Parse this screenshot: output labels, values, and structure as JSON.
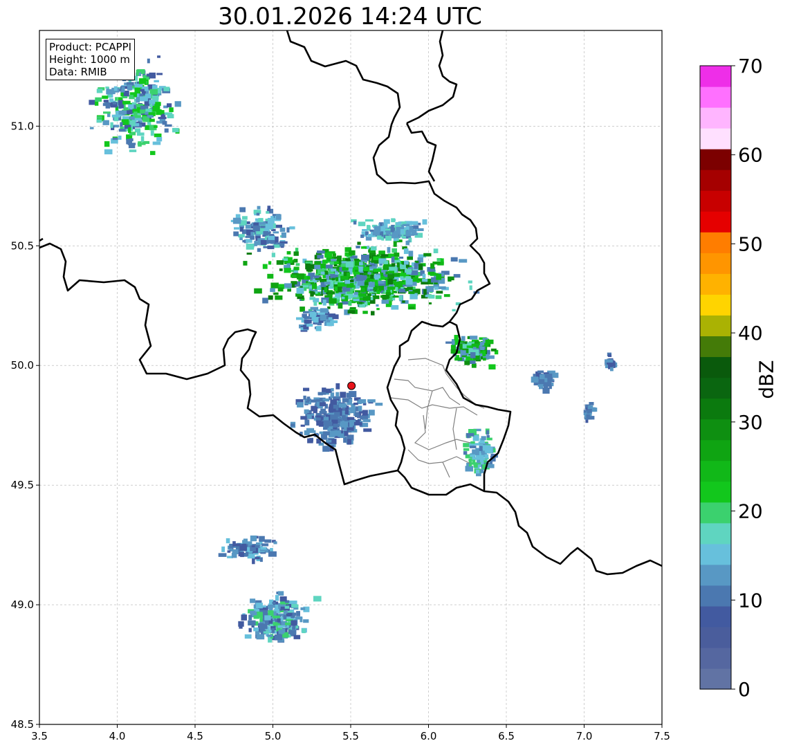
{
  "title": "30.01.2026 14:24 UTC",
  "info": {
    "product": "Product: PCAPPI",
    "height": "Height: 1000 m",
    "source": "Data: RMIB"
  },
  "axes": {
    "x_ticks": [
      "3.5",
      "4.0",
      "4.5",
      "5.0",
      "5.5",
      "6.0",
      "6.5",
      "7.0",
      "7.5"
    ],
    "y_ticks": [
      "48.5",
      "49.0",
      "49.5",
      "50.0",
      "50.5",
      "51.0"
    ],
    "xlim": [
      3.5,
      7.5
    ],
    "ylim": [
      48.5,
      51.4
    ],
    "grid": true
  },
  "radar_site": {
    "lon": 5.505,
    "lat": 49.915,
    "color": "#e8141a"
  },
  "colorbar": {
    "label": "dBZ",
    "ticks": [
      "0",
      "10",
      "20",
      "30",
      "40",
      "50",
      "60",
      "70"
    ],
    "range": [
      0,
      70
    ],
    "colors": [
      "#6173a4",
      "#5567a0",
      "#4a5d9c",
      "#425aa0",
      "#4b78b0",
      "#5898c4",
      "#67c0dc",
      "#5fd5c0",
      "#3bd16e",
      "#12c71c",
      "#11b818",
      "#0fa412",
      "#0e8f11",
      "#0b7a0e",
      "#0a6610",
      "#0a5a0c",
      "#447b08",
      "#aab203",
      "#ffd400",
      "#ffb200",
      "#ff9500",
      "#ff7d00",
      "#e50000",
      "#c80000",
      "#a50000",
      "#7c0000",
      "#ffe0ff",
      "#ffb5ff",
      "#ff70ff",
      "#ee2ee8"
    ]
  }
}
